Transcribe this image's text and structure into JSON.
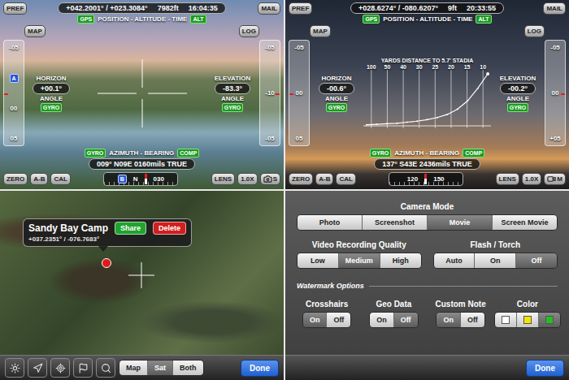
{
  "views": [
    {
      "kind": "crosshair",
      "header": {
        "coords": "+042.2001° / +023.3084°",
        "altitude": "7982ft",
        "time": "16:04:35",
        "badges": [
          {
            "text": "GPS",
            "kind": "badge"
          },
          {
            "text": "POSITION - ALTITUDE - TIME",
            "kind": "title"
          },
          {
            "text": "ALT",
            "kind": "badge"
          }
        ]
      },
      "buttons": {
        "top_left": "PREF",
        "top_right": "MAIL",
        "left": "MAP",
        "right": "LOG"
      },
      "left_scale": {
        "labels": [
          "-05",
          "00",
          "05"
        ],
        "marker": "A"
      },
      "right_scale": {
        "labels": [
          "-05",
          "-10",
          "-05"
        ]
      },
      "horizon": {
        "label": "HORIZON",
        "value": "+00.1°",
        "sub": "ANGLE",
        "badge": "GYRO"
      },
      "elevation": {
        "label": "ELEVATION",
        "value": "-83.3°",
        "sub": "ANGLE",
        "badge": "GYRO"
      },
      "azimuth": {
        "badges": [
          {
            "text": "GYRO",
            "kind": "badge"
          },
          {
            "text": "AZIMUTH - BEARING",
            "kind": "title"
          },
          {
            "text": "COMP",
            "kind": "badge"
          }
        ],
        "reading": "009° N09E 0160mils TRUE"
      },
      "toolbar_left": [
        "ZERO",
        "A-B",
        "CAL"
      ],
      "compass": {
        "labels": [
          "N",
          "030"
        ],
        "marker": "B"
      },
      "toolbar_right": [
        "LENS",
        "1.0X"
      ],
      "capture": {
        "kind": "photo",
        "label": "S"
      }
    },
    {
      "kind": "stadia",
      "header": {
        "coords": "+028.6274° / -080.6207°",
        "altitude": "9ft",
        "time": "20:33:55",
        "badges": [
          {
            "text": "GPS",
            "kind": "badge"
          },
          {
            "text": "POSITION - ALTITUDE - TIME",
            "kind": "title"
          },
          {
            "text": "ALT",
            "kind": "badge"
          }
        ]
      },
      "buttons": {
        "top_left": "PREF",
        "top_right": "MAIL",
        "left": "MAP",
        "right": "LOG"
      },
      "left_scale": {
        "labels": [
          "-05",
          "00",
          "05"
        ]
      },
      "right_scale": {
        "labels": [
          "-05",
          "00",
          "+05"
        ]
      },
      "horizon": {
        "label": "HORIZON",
        "value": "-00.6°",
        "sub": "ANGLE",
        "badge": "GYRO"
      },
      "elevation": {
        "label": "ELEVATION",
        "value": "-00.2°",
        "sub": "ANGLE",
        "badge": "GYRO"
      },
      "chart": {
        "title": "YARDS DISTANCE TO 5.7' STADIA",
        "ticks": [
          "100",
          "50",
          "40",
          "30",
          "25",
          "20",
          "15",
          "10"
        ],
        "curve": [
          2,
          3,
          4,
          5,
          7,
          9,
          12,
          16,
          22,
          32,
          48,
          72,
          100
        ]
      },
      "azimuth": {
        "badges": [
          {
            "text": "GYRO",
            "kind": "badge"
          },
          {
            "text": "AZIMUTH - BEARING",
            "kind": "title"
          },
          {
            "text": "COMP",
            "kind": "badge"
          }
        ],
        "reading": "137° S43E 2436mils TRUE"
      },
      "toolbar_left": [
        "ZERO",
        "A-B",
        "CAL"
      ],
      "compass": {
        "labels": [
          "120",
          "150"
        ]
      },
      "toolbar_right": [
        "LENS",
        "1.0X"
      ],
      "capture": {
        "kind": "movie",
        "label": "M"
      }
    }
  ],
  "map": {
    "pin": {
      "title": "Sandy Bay Camp",
      "coords": "+037.2351° / -076.7683°",
      "actions": [
        {
          "label": "Share",
          "color": "#21a32f"
        },
        {
          "label": "Delete",
          "color": "#cf1f1f"
        }
      ]
    },
    "map_types": [
      {
        "label": "Map",
        "selected": false
      },
      {
        "label": "Sat",
        "selected": true
      },
      {
        "label": "Both",
        "selected": false
      }
    ],
    "done": "Done"
  },
  "settings": {
    "camera_mode": {
      "title": "Camera Mode",
      "options": [
        {
          "label": "Photo",
          "selected": false
        },
        {
          "label": "Screenshot",
          "selected": false
        },
        {
          "label": "Movie",
          "selected": true
        },
        {
          "label": "Screen Movie",
          "selected": false
        }
      ]
    },
    "row": [
      {
        "title": "Video Recording Quality",
        "options": [
          {
            "label": "Low",
            "selected": false
          },
          {
            "label": "Medium",
            "selected": true
          },
          {
            "label": "High",
            "selected": false
          }
        ]
      },
      {
        "title": "Flash / Torch",
        "options": [
          {
            "label": "Auto",
            "selected": false
          },
          {
            "label": "On",
            "selected": false
          },
          {
            "label": "Off",
            "selected": true
          }
        ]
      }
    ],
    "watermark": {
      "title": "Watermark Options",
      "groups": [
        {
          "title": "Crosshairs",
          "kind": "text",
          "options": [
            {
              "label": "On",
              "selected": true
            },
            {
              "label": "Off",
              "selected": false
            }
          ]
        },
        {
          "title": "Geo Data",
          "kind": "text",
          "options": [
            {
              "label": "On",
              "selected": false
            },
            {
              "label": "Off",
              "selected": true
            }
          ]
        },
        {
          "title": "Custom Note",
          "kind": "text",
          "options": [
            {
              "label": "On",
              "selected": true
            },
            {
              "label": "Off",
              "selected": false
            }
          ]
        },
        {
          "title": "Color",
          "kind": "swatch",
          "options": [
            {
              "color": "#ffffff",
              "selected": false
            },
            {
              "color": "#f2e600",
              "selected": false
            },
            {
              "color": "#22c022",
              "selected": true
            }
          ]
        }
      ]
    },
    "done": "Done"
  }
}
